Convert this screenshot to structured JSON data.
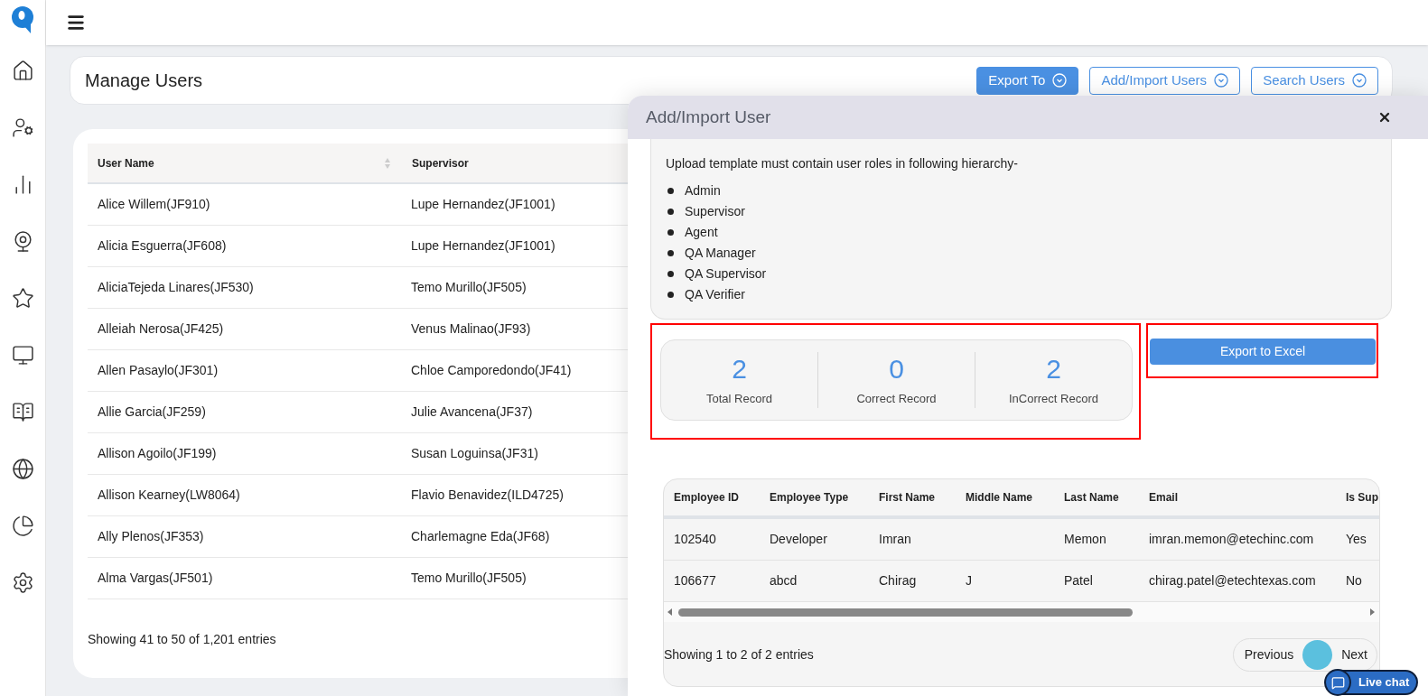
{
  "page": {
    "title": "Manage Users",
    "actions": [
      {
        "label": "Export To",
        "kind": "primary"
      },
      {
        "label": "Add/Import Users",
        "kind": "outline"
      },
      {
        "label": "Search Users",
        "kind": "outline"
      }
    ]
  },
  "users_table": {
    "columns": [
      "User Name",
      "Supervisor"
    ],
    "rows": [
      [
        "Alice Willem(JF910)",
        "Lupe Hernandez(JF1001)"
      ],
      [
        "Alicia Esguerra(JF608)",
        "Lupe Hernandez(JF1001)"
      ],
      [
        "AliciaTejeda Linares(JF530)",
        "Temo Murillo(JF505)"
      ],
      [
        "Alleiah Nerosa(JF425)",
        "Venus Malinao(JF93)"
      ],
      [
        "Allen Pasaylo(JF301)",
        "Chloe Camporedondo(JF41)"
      ],
      [
        "Allie Garcia(JF259)",
        "Julie Avancena(JF37)"
      ],
      [
        "Allison Agoilo(JF199)",
        "Susan Loguinsa(JF31)"
      ],
      [
        "Allison Kearney(LW8064)",
        "Flavio Benavidez(ILD4725)"
      ],
      [
        "Ally Plenos(JF353)",
        "Charlemagne Eda(JF68)"
      ],
      [
        "Alma Vargas(JF501)",
        "Temo Murillo(JF505)"
      ]
    ],
    "footer": "Showing 41 to 50 of 1,201 entries"
  },
  "modal": {
    "title": "Add/Import User",
    "note": "Upload template must contain user roles in following hierarchy-",
    "roles": [
      "Admin",
      "Supervisor",
      "Agent",
      "QA Manager",
      "QA Supervisor",
      "QA Verifier"
    ],
    "stats": [
      {
        "value": "2",
        "label": "Total Record"
      },
      {
        "value": "0",
        "label": "Correct Record"
      },
      {
        "value": "2",
        "label": "InCorrect Record"
      }
    ],
    "export_button": "Export to Excel",
    "table": {
      "columns": [
        "Employee ID",
        "Employee Type",
        "First Name",
        "Middle Name",
        "Last Name",
        "Email",
        "Is Sup"
      ],
      "rows": [
        [
          "102540",
          "Developer",
          "Imran",
          "",
          "Memon",
          "imran.memon@etechinc.com",
          "Yes"
        ],
        [
          "106677",
          "abcd",
          "Chirag",
          "J",
          "Patel",
          "chirag.patel@etechtexas.com",
          "No"
        ]
      ]
    },
    "footer": "Showing 1 to 2 of 2 entries",
    "pagination": {
      "previous": "Previous",
      "pages": [
        {
          "selected": true
        }
      ],
      "next": "Next"
    }
  },
  "live_chat": {
    "label": "Live chat"
  }
}
